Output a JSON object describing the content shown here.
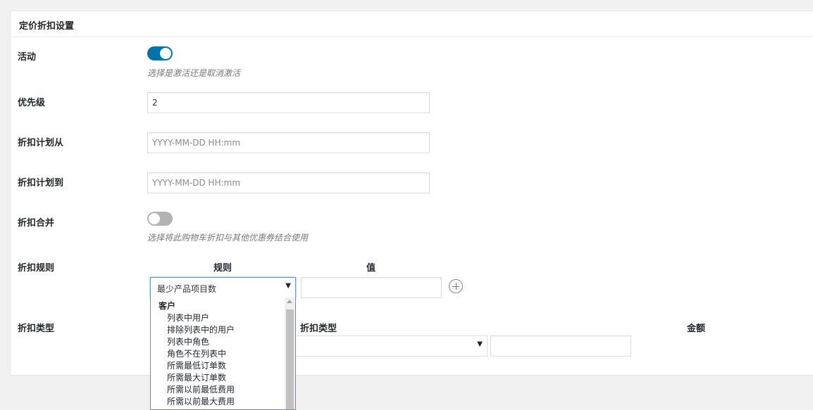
{
  "panel": {
    "title": "定价折扣设置"
  },
  "fields": {
    "active": {
      "label": "活动",
      "enabled": true,
      "description": "选择是激活还是取消激活"
    },
    "priority": {
      "label": "优先级",
      "value": "2"
    },
    "schedule_from": {
      "label": "折扣计划从",
      "placeholder": "YYYY-MM-DD HH:mm"
    },
    "schedule_to": {
      "label": "折扣计划到",
      "placeholder": "YYYY-MM-DD HH:mm"
    },
    "combine": {
      "label": "折扣合并",
      "enabled": false,
      "description": "选择将此购物车折扣与其他优惠券结合使用"
    },
    "rules": {
      "label": "折扣规则",
      "col_rule": "规则",
      "col_value": "值",
      "selected_rule": "最少产品项目数",
      "value": ""
    },
    "discount_type": {
      "label": "折扣类型",
      "col_type": "折扣类型",
      "col_amount": "金额",
      "selected_type": "",
      "amount": ""
    }
  },
  "dropdown": {
    "group": "客户",
    "options": [
      "列表中用户",
      "排除列表中的用户",
      "列表中角色",
      "角色不在列表中",
      "所需最低订单数",
      "所需最大订单数",
      "所需以前最低费用",
      "所需以前最大费用"
    ]
  },
  "icons": {
    "add": "plus-circle-icon",
    "select_arrow": "caret-down-icon"
  },
  "colors": {
    "toggle_on": "#0073aa",
    "toggle_off": "#b3b3b3",
    "focus_border": "#5b9dd9"
  }
}
